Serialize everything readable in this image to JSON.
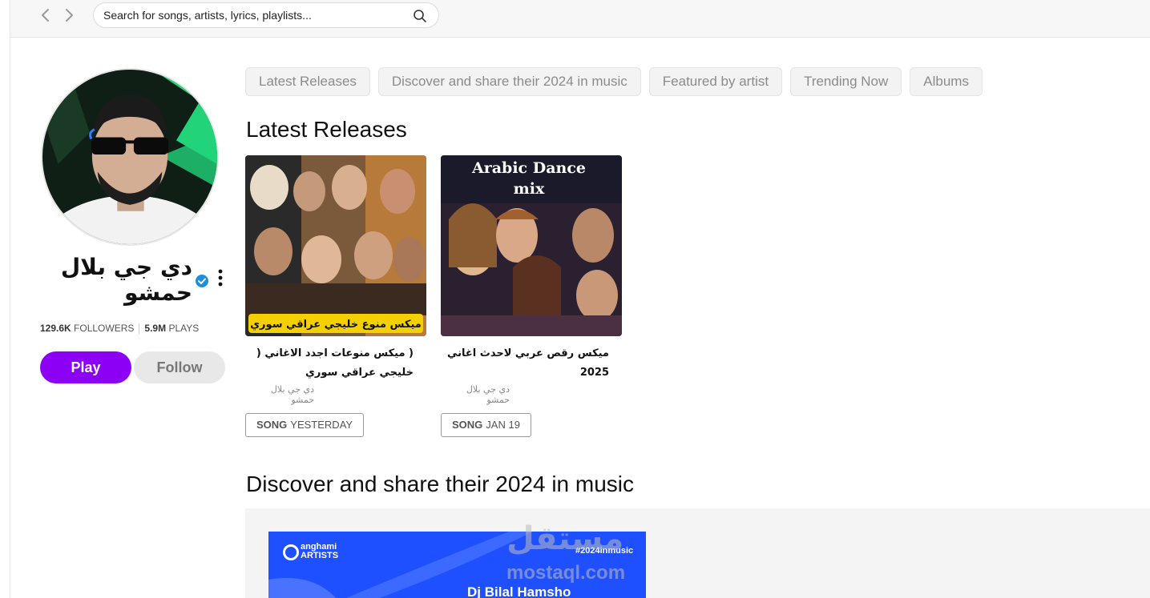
{
  "search": {
    "placeholder": "Search for songs, artists, lyrics, playlists..."
  },
  "artist": {
    "name": "دي جي بلال حمشو",
    "followers_count": "129.6K",
    "followers_label": "FOLLOWERS",
    "plays_count": "5.9M",
    "plays_label": "PLAYS",
    "verified": true
  },
  "actions": {
    "play_label": "Play",
    "follow_label": "Follow"
  },
  "tabs": [
    {
      "label": "Latest Releases"
    },
    {
      "label": "Discover and share their 2024 in music"
    },
    {
      "label": "Featured by artist"
    },
    {
      "label": "Trending Now"
    },
    {
      "label": "Albums"
    }
  ],
  "latest": {
    "title": "Latest Releases",
    "items": [
      {
        "title": "( ميكس منوعات اجدد الاغاني ( خليجي عراقي سوري",
        "artist": "دي جي بلال حمشو",
        "type": "SONG",
        "date": "YESTERDAY",
        "cover_caption": "ميكس منوع خليجي عراقي سوري"
      },
      {
        "title": "ميكس رقص عربي لاحدث اغاني 2025",
        "artist": "دي جي بلال حمشو",
        "type": "SONG",
        "date": "JAN 19",
        "cover_caption_line1": "Arabic Dance",
        "cover_caption_line2": "mix"
      }
    ]
  },
  "discover": {
    "title": "Discover and share their 2024 in music",
    "banner_logo_line1": "anghami",
    "banner_logo_line2": "ARTISTS",
    "banner_hashtag": "#2024inmusic",
    "banner_artist": "Dj Bilal Hamsho"
  },
  "watermark": {
    "arabic": "مستقل",
    "latin": "mostaql.com"
  },
  "colors": {
    "accent": "#8c00f5",
    "verified": "#1d8fe0",
    "banner": "#1f50ff"
  }
}
